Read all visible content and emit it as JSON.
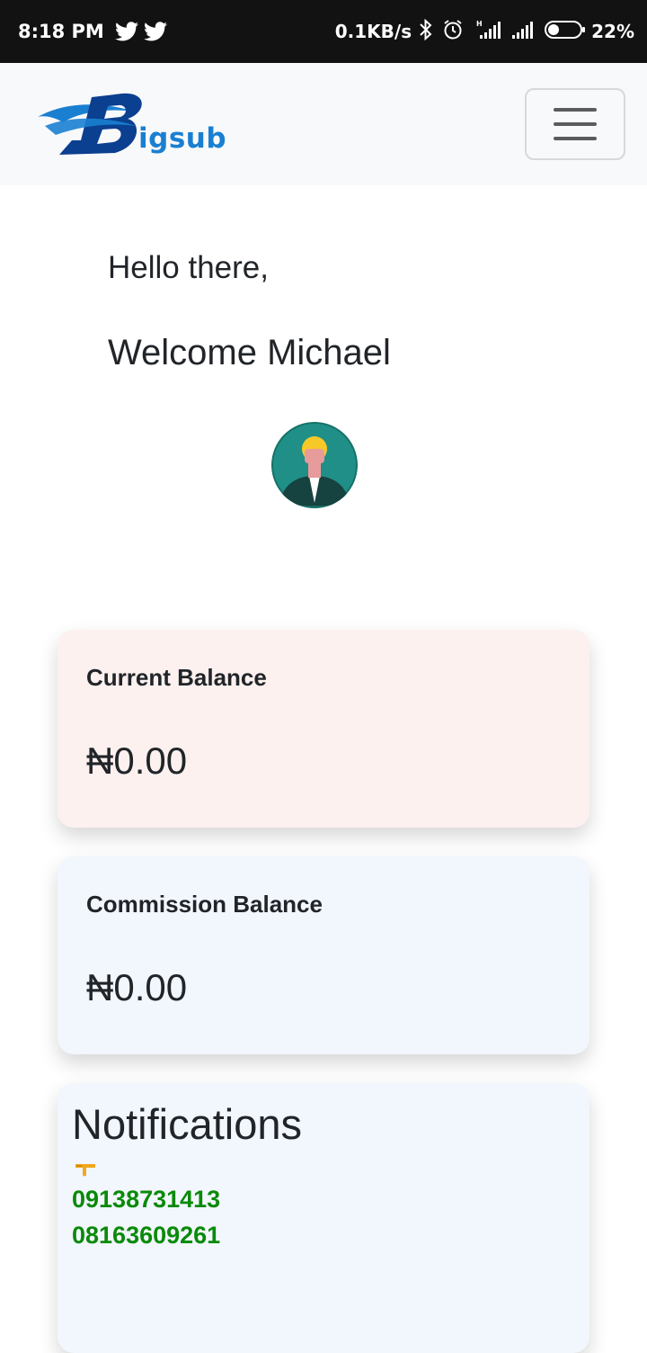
{
  "status_bar": {
    "time": "8:18 PM",
    "left_icons": [
      "twitter-icon",
      "twitter-icon"
    ],
    "network_speed": "0.1KB/s",
    "right_icons": [
      "bluetooth-icon",
      "alarm-icon",
      "signal-icon",
      "signal-icon",
      "battery-icon"
    ],
    "battery_percent": "22%",
    "battery_level": 0.22
  },
  "navbar": {
    "brand_text": "igsub",
    "brand_colors": {
      "wave": "#1a7fd1",
      "letter": "#0b3f8f"
    },
    "toggler_icon": "hamburger-icon"
  },
  "greeting": {
    "hello": "Hello there,",
    "welcome": "Welcome Michael"
  },
  "avatar": {
    "icon": "user-avatar-icon"
  },
  "cards": {
    "current": {
      "title": "Current Balance",
      "amount": "₦0.00",
      "bg": "#fcf1ef"
    },
    "commission": {
      "title": "Commission Balance",
      "amount": "₦0.00",
      "bg": "#f2f6fd"
    }
  },
  "notifications": {
    "title": "Notifications",
    "pointer_icon": "pointing-hand-icon",
    "phones": [
      "09138731413",
      "08163609261"
    ],
    "phone_color": "#0a8a0a"
  }
}
